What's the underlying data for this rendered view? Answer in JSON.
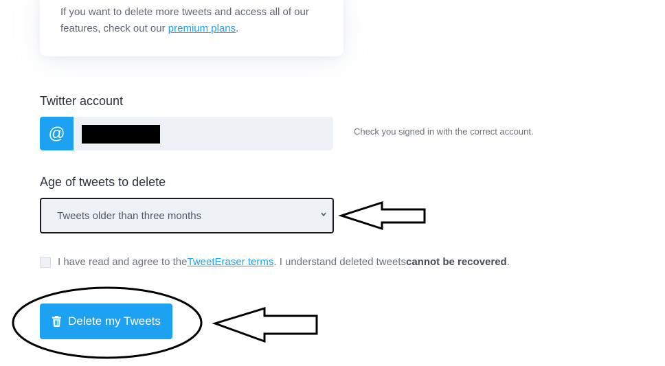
{
  "info_card": {
    "text_before": "If you want to delete more tweets and access all of our features, check out our ",
    "link_text": "premium plans",
    "text_after": "."
  },
  "account": {
    "label": "Twitter account",
    "addon_symbol": "@",
    "hint": "Check you signed in with the correct account."
  },
  "age": {
    "label": "Age of tweets to delete",
    "selected": "Tweets older than three months"
  },
  "terms": {
    "text_before": "I have read and agree to the ",
    "link_text": "TweetEraser terms",
    "text_middle": ". I understand deleted tweets ",
    "bold_text": "cannot be recovered",
    "text_after": "."
  },
  "delete_button": {
    "label": "Delete my Tweets",
    "icon": "trash-icon"
  },
  "colors": {
    "accent": "#1da1f2",
    "input_bg": "#eef1f6"
  }
}
